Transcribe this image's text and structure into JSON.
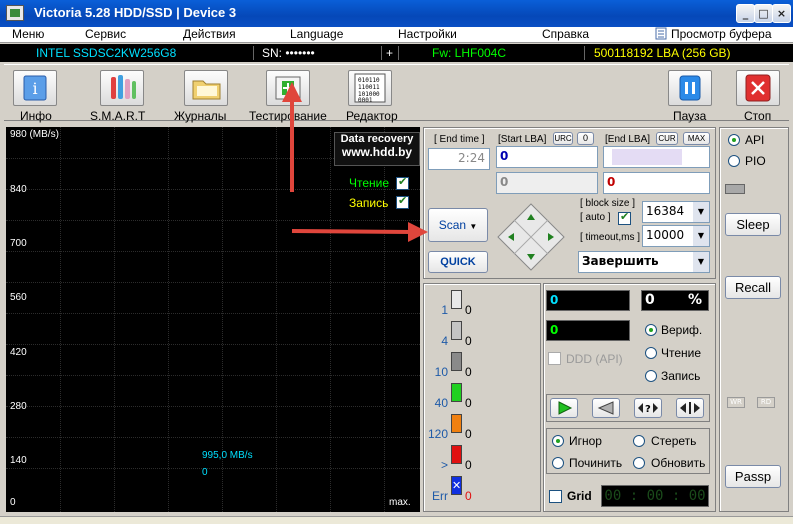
{
  "window": {
    "title": "Victoria 5.28 HDD/SSD | Device 3"
  },
  "menu": [
    "Меню",
    "Сервис",
    "Действия",
    "Language",
    "Настройки",
    "Справка",
    "Просмотр буфера"
  ],
  "device": {
    "model": "INTEL SSDSC2KW256G8",
    "sn": "SN: •••••••",
    "plus": "+",
    "fw": "Fw: LHF004C",
    "lba": "500118192 LBA (256 GB)"
  },
  "toolbar": {
    "info": "Инфо",
    "smart": "S.M.A.R.T",
    "logs": "Журналы",
    "test": "Тестирование",
    "editor": "Редактор",
    "pause": "Пауза",
    "stop": "Стоп"
  },
  "graph": {
    "y_labels": [
      "980 (MB/s)",
      "840",
      "700",
      "560",
      "420",
      "280",
      "140",
      "0"
    ],
    "data_recovery_line1": "Data recovery",
    "data_recovery_line2": "www.hdd.by",
    "read_label": "Чтение",
    "write_label": "Запись",
    "speed_value": "995,0 MB/s",
    "speed_zero": "0",
    "max_label": "max."
  },
  "scan": {
    "end_time_label": "[ End time ]",
    "end_time_value": "2:24",
    "start_lba_label": "[Start LBA]",
    "urc": "URC",
    "zero_btn": "0",
    "end_lba_label": "[End LBA]",
    "cur": "CUR",
    "max": "MAX",
    "start_lba_value": "0",
    "start_lba_value2": "0",
    "end_lba_value2": "0",
    "scan_btn": "Scan",
    "quick_btn": "QUICK",
    "block_size_label": "[ block size ]",
    "auto_label": "[ auto ]",
    "block_size_value": "16384",
    "timeout_label": "[ timeout,ms ]",
    "timeout_value": "10000",
    "finish_select": "Завершить"
  },
  "blocks": [
    {
      "label": "1",
      "count": "0",
      "color": "#e8e8e8"
    },
    {
      "label": "4",
      "count": "0",
      "color": "#c4c4c4"
    },
    {
      "label": "10",
      "count": "0",
      "color": "#8a8a8a"
    },
    {
      "label": "40",
      "count": "0",
      "color": "#20d020"
    },
    {
      "label": "120",
      "count": "0",
      "color": "#f08010"
    },
    {
      "label": ">",
      "count": "0",
      "color": "#e01010"
    },
    {
      "label": "Err",
      "count": "0",
      "color": "#1030e0"
    }
  ],
  "stats": {
    "counter1": "0",
    "percent": "0",
    "percent_sign": "%",
    "counter2": "0",
    "ddd_label": "DDD (API)",
    "verify": "Вериф.",
    "read": "Чтение",
    "write": "Запись",
    "ignore": "Игнор",
    "erase": "Стереть",
    "repair": "Починить",
    "refresh": "Обновить",
    "grid_label": "Grid",
    "timer": "00 : 00 : 00"
  },
  "side": {
    "api": "API",
    "pio": "PIO",
    "sleep": "Sleep",
    "recall": "Recall",
    "passp": "Passp",
    "wr": "WR",
    "rd": "RD"
  },
  "colors": {
    "accent_red": "#e0463c",
    "title_blue": "#0548b8",
    "cyan": "#00e0ff",
    "green": "#00ff00",
    "yellow": "#ffff00"
  }
}
